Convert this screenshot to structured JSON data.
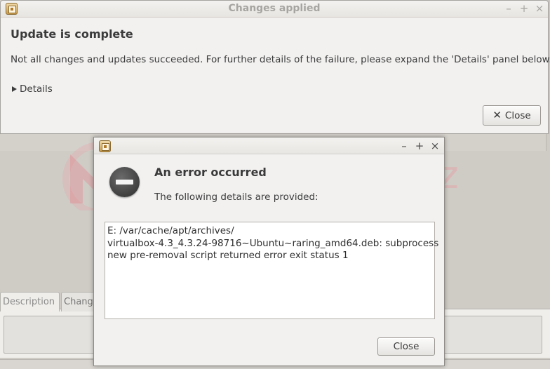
{
  "background": {
    "tabs": [
      {
        "label": "Description"
      },
      {
        "label": "Chang"
      }
    ]
  },
  "main_window": {
    "title": "Changes applied",
    "controls": {
      "minimize": "–",
      "maximize": "+",
      "close": "×"
    },
    "heading": "Update is complete",
    "message": "Not all changes and updates succeeded. For further details of the failure, please expand the 'Details' panel below.",
    "details_label": "Details",
    "close_label": "Close"
  },
  "watermark": {
    "text": "MehcanGökgöz"
  },
  "error_dialog": {
    "controls": {
      "minimize": "–",
      "maximize": "+",
      "close": "×"
    },
    "heading": "An error occurred",
    "message": "The following details are provided:",
    "details_lines": [
      "E: /var/cache/apt/archives/",
      "virtualbox-4.3_4.3.24-98716~Ubuntu~raring_amd64.deb: subprocess",
      "new pre-removal script returned error exit status 1"
    ],
    "close_label": "Close"
  },
  "colors": {
    "window_bg": "#f2f1f0",
    "title_inactive": "#a7a5a2",
    "text": "#3c3c3c",
    "error_icon": "#2d2d2d",
    "watermark": "#ec96a0"
  }
}
